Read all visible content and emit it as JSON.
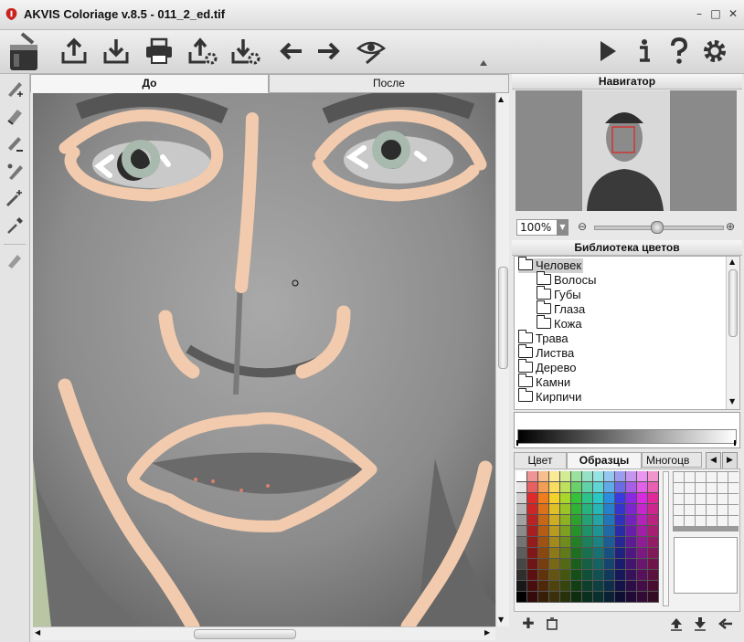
{
  "window": {
    "title": "AKVIS Coloriage v.8.5 - 011_2_ed.tif",
    "minimize": "–",
    "maximize": "□",
    "close": "✕"
  },
  "toolbar": {
    "icons": [
      "paint-bucket-logo",
      "open-icon",
      "save-icon",
      "print-icon",
      "export-settings-icon",
      "save-settings-icon",
      "undo-icon",
      "redo-icon",
      "eye-preview-icon",
      "run-icon",
      "info-icon",
      "help-icon",
      "settings-icon"
    ]
  },
  "left_tools": [
    "pencil-tool",
    "eraser-tool",
    "keep-color-pencil-tool",
    "paint-bucket-tool",
    "magic-tool",
    "eyedropper-tool",
    "erase-strokes-tool"
  ],
  "canvas": {
    "tab_before": "До",
    "tab_after": "После"
  },
  "navigator": {
    "title": "Навигатор",
    "zoom": "100%"
  },
  "library": {
    "title": "Библиотека цветов",
    "items": [
      {
        "label": "Человек",
        "level": 0,
        "selected": true
      },
      {
        "label": "Волосы",
        "level": 1
      },
      {
        "label": "Губы",
        "level": 1
      },
      {
        "label": "Глаза",
        "level": 1
      },
      {
        "label": "Кожа",
        "level": 1
      },
      {
        "label": "Трава",
        "level": 0
      },
      {
        "label": "Листва",
        "level": 0
      },
      {
        "label": "Дерево",
        "level": 0
      },
      {
        "label": "Камни",
        "level": 0
      },
      {
        "label": "Кирпичи",
        "level": 0
      }
    ]
  },
  "color_tabs": {
    "tab_color": "Цвет",
    "tab_samples": "Образцы",
    "tab_many": "Многоцв"
  },
  "palette_hues": [
    "#ffffff",
    "#e02a2a",
    "#f07d1c",
    "#f5d22a",
    "#a9d62a",
    "#35c23a",
    "#2cc28a",
    "#2ac7c7",
    "#2a8de0",
    "#3a3ae0",
    "#8a2ae0",
    "#d82ae0",
    "#e02a9a"
  ],
  "colors": {
    "skin_stroke": "#f2cbae",
    "eye_stroke": "#a8b9ad",
    "lip_dots": "#d8806e",
    "panel_bg": "#e8e8e8"
  }
}
